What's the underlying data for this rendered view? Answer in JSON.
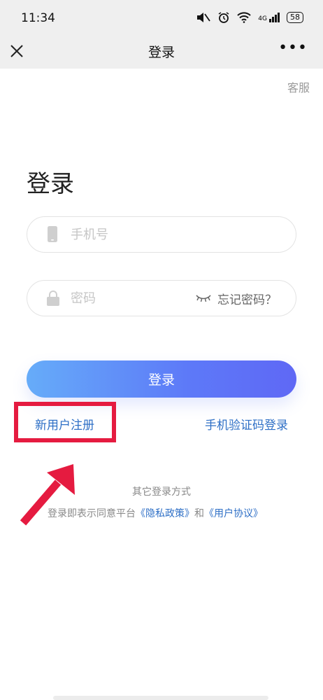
{
  "status_bar": {
    "time": "11:34",
    "icons": [
      "mute-icon",
      "alarm-icon",
      "wifi-icon",
      "signal-icon"
    ],
    "signal_label": "4G",
    "battery": "58"
  },
  "nav": {
    "close_icon": "close-icon",
    "title": "登录",
    "more_icon": "more-icon",
    "more_label": "•••"
  },
  "service_label": "客服",
  "page_title": "登录",
  "phone_field": {
    "icon": "phone-icon",
    "placeholder": "手机号",
    "value": ""
  },
  "password_field": {
    "icon": "lock-icon",
    "placeholder": "密码",
    "value": "",
    "toggle_icon": "eye-closed-icon",
    "forgot_label": "忘记密码？"
  },
  "login_button": "登录",
  "register_link": "新用户注册",
  "sms_login_link": "手机验证码登录",
  "other_methods": "其它登录方式",
  "agreement": {
    "prefix": "登录即表示同意平台",
    "privacy": "《隐私政策》",
    "and": "和",
    "terms": "《用户协议》"
  },
  "colors": {
    "accent": "#2e6fc6",
    "button_start": "#66acf9",
    "button_end": "#5f68f5",
    "highlight": "#e51b40",
    "header_bg": "#efefef"
  }
}
